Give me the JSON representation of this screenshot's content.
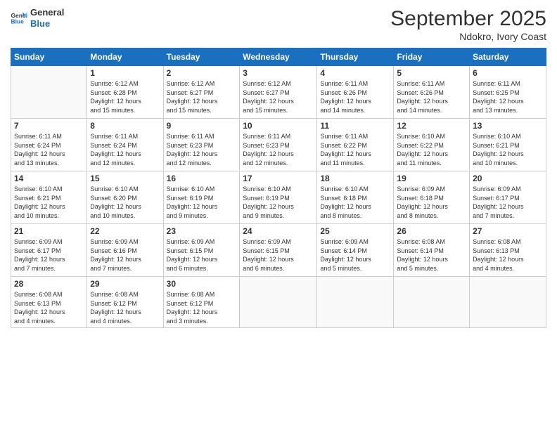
{
  "logo": {
    "line1": "General",
    "line2": "Blue"
  },
  "title": "September 2025",
  "location": "Ndokro, Ivory Coast",
  "days_header": [
    "Sunday",
    "Monday",
    "Tuesday",
    "Wednesday",
    "Thursday",
    "Friday",
    "Saturday"
  ],
  "weeks": [
    [
      {
        "num": "",
        "info": ""
      },
      {
        "num": "1",
        "info": "Sunrise: 6:12 AM\nSunset: 6:28 PM\nDaylight: 12 hours\nand 15 minutes."
      },
      {
        "num": "2",
        "info": "Sunrise: 6:12 AM\nSunset: 6:27 PM\nDaylight: 12 hours\nand 15 minutes."
      },
      {
        "num": "3",
        "info": "Sunrise: 6:12 AM\nSunset: 6:27 PM\nDaylight: 12 hours\nand 15 minutes."
      },
      {
        "num": "4",
        "info": "Sunrise: 6:11 AM\nSunset: 6:26 PM\nDaylight: 12 hours\nand 14 minutes."
      },
      {
        "num": "5",
        "info": "Sunrise: 6:11 AM\nSunset: 6:26 PM\nDaylight: 12 hours\nand 14 minutes."
      },
      {
        "num": "6",
        "info": "Sunrise: 6:11 AM\nSunset: 6:25 PM\nDaylight: 12 hours\nand 13 minutes."
      }
    ],
    [
      {
        "num": "7",
        "info": "Sunrise: 6:11 AM\nSunset: 6:24 PM\nDaylight: 12 hours\nand 13 minutes."
      },
      {
        "num": "8",
        "info": "Sunrise: 6:11 AM\nSunset: 6:24 PM\nDaylight: 12 hours\nand 12 minutes."
      },
      {
        "num": "9",
        "info": "Sunrise: 6:11 AM\nSunset: 6:23 PM\nDaylight: 12 hours\nand 12 minutes."
      },
      {
        "num": "10",
        "info": "Sunrise: 6:11 AM\nSunset: 6:23 PM\nDaylight: 12 hours\nand 12 minutes."
      },
      {
        "num": "11",
        "info": "Sunrise: 6:11 AM\nSunset: 6:22 PM\nDaylight: 12 hours\nand 11 minutes."
      },
      {
        "num": "12",
        "info": "Sunrise: 6:10 AM\nSunset: 6:22 PM\nDaylight: 12 hours\nand 11 minutes."
      },
      {
        "num": "13",
        "info": "Sunrise: 6:10 AM\nSunset: 6:21 PM\nDaylight: 12 hours\nand 10 minutes."
      }
    ],
    [
      {
        "num": "14",
        "info": "Sunrise: 6:10 AM\nSunset: 6:21 PM\nDaylight: 12 hours\nand 10 minutes."
      },
      {
        "num": "15",
        "info": "Sunrise: 6:10 AM\nSunset: 6:20 PM\nDaylight: 12 hours\nand 10 minutes."
      },
      {
        "num": "16",
        "info": "Sunrise: 6:10 AM\nSunset: 6:19 PM\nDaylight: 12 hours\nand 9 minutes."
      },
      {
        "num": "17",
        "info": "Sunrise: 6:10 AM\nSunset: 6:19 PM\nDaylight: 12 hours\nand 9 minutes."
      },
      {
        "num": "18",
        "info": "Sunrise: 6:10 AM\nSunset: 6:18 PM\nDaylight: 12 hours\nand 8 minutes."
      },
      {
        "num": "19",
        "info": "Sunrise: 6:09 AM\nSunset: 6:18 PM\nDaylight: 12 hours\nand 8 minutes."
      },
      {
        "num": "20",
        "info": "Sunrise: 6:09 AM\nSunset: 6:17 PM\nDaylight: 12 hours\nand 7 minutes."
      }
    ],
    [
      {
        "num": "21",
        "info": "Sunrise: 6:09 AM\nSunset: 6:17 PM\nDaylight: 12 hours\nand 7 minutes."
      },
      {
        "num": "22",
        "info": "Sunrise: 6:09 AM\nSunset: 6:16 PM\nDaylight: 12 hours\nand 7 minutes."
      },
      {
        "num": "23",
        "info": "Sunrise: 6:09 AM\nSunset: 6:15 PM\nDaylight: 12 hours\nand 6 minutes."
      },
      {
        "num": "24",
        "info": "Sunrise: 6:09 AM\nSunset: 6:15 PM\nDaylight: 12 hours\nand 6 minutes."
      },
      {
        "num": "25",
        "info": "Sunrise: 6:09 AM\nSunset: 6:14 PM\nDaylight: 12 hours\nand 5 minutes."
      },
      {
        "num": "26",
        "info": "Sunrise: 6:08 AM\nSunset: 6:14 PM\nDaylight: 12 hours\nand 5 minutes."
      },
      {
        "num": "27",
        "info": "Sunrise: 6:08 AM\nSunset: 6:13 PM\nDaylight: 12 hours\nand 4 minutes."
      }
    ],
    [
      {
        "num": "28",
        "info": "Sunrise: 6:08 AM\nSunset: 6:13 PM\nDaylight: 12 hours\nand 4 minutes."
      },
      {
        "num": "29",
        "info": "Sunrise: 6:08 AM\nSunset: 6:12 PM\nDaylight: 12 hours\nand 4 minutes."
      },
      {
        "num": "30",
        "info": "Sunrise: 6:08 AM\nSunset: 6:12 PM\nDaylight: 12 hours\nand 3 minutes."
      },
      {
        "num": "",
        "info": ""
      },
      {
        "num": "",
        "info": ""
      },
      {
        "num": "",
        "info": ""
      },
      {
        "num": "",
        "info": ""
      }
    ]
  ]
}
